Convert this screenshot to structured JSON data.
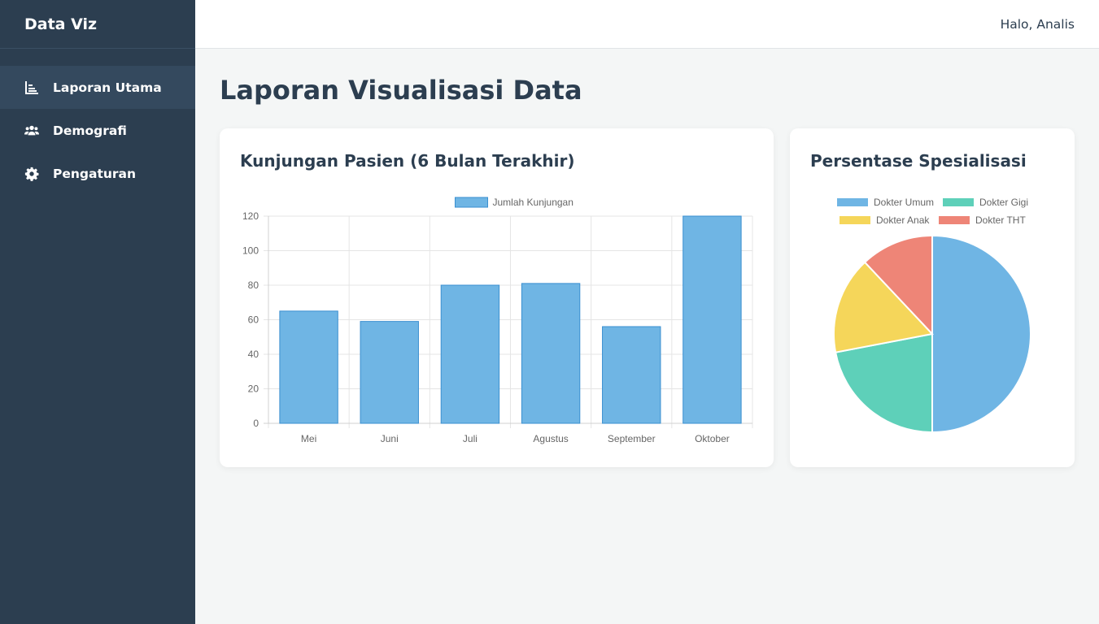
{
  "app": {
    "brand": "Data Viz"
  },
  "sidebar": {
    "items": [
      {
        "label": "Laporan Utama",
        "icon": "bar-chart-icon",
        "active": true
      },
      {
        "label": "Demografi",
        "icon": "users-icon",
        "active": false
      },
      {
        "label": "Pengaturan",
        "icon": "gear-icon",
        "active": false
      }
    ]
  },
  "topbar": {
    "greeting": "Halo, Analis"
  },
  "main": {
    "title": "Laporan Visualisasi Data"
  },
  "cards": {
    "bar": {
      "title": "Kunjungan Pasien (6 Bulan Terakhir)"
    },
    "pie": {
      "title": "Persentase Spesialisasi"
    }
  },
  "colors": {
    "sidebar": "#2c3e50",
    "bar_fill": "#6fb5e4",
    "bar_stroke": "#3a8fd0",
    "pie": [
      "#6fb5e4",
      "#5ed0b9",
      "#f5d65a",
      "#ee8577"
    ]
  },
  "chart_data": [
    {
      "type": "bar",
      "categories": [
        "Mei",
        "Juni",
        "Juli",
        "Agustus",
        "September",
        "Oktober"
      ],
      "series": [
        {
          "name": "Jumlah Kunjungan",
          "values": [
            65,
            59,
            80,
            81,
            56,
            120
          ]
        }
      ],
      "ylim": [
        0,
        120
      ],
      "yticks": [
        0,
        20,
        40,
        60,
        80,
        100,
        120
      ],
      "grid": true,
      "legend": "top-center"
    },
    {
      "type": "pie",
      "labels": [
        "Dokter Umum",
        "Dokter Gigi",
        "Dokter Anak",
        "Dokter THT"
      ],
      "values": [
        50,
        22,
        16,
        12
      ],
      "legend": "top-center"
    }
  ]
}
